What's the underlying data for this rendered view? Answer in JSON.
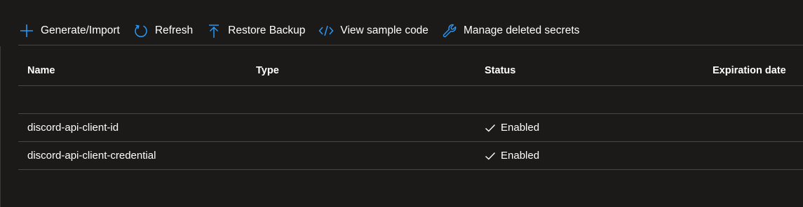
{
  "toolbar": {
    "generate": "Generate/Import",
    "refresh": "Refresh",
    "restore": "Restore Backup",
    "sample": "View sample code",
    "deleted": "Manage deleted secrets"
  },
  "icons": {
    "accent": "#2899f5"
  },
  "table": {
    "columns": [
      "Name",
      "Type",
      "Status",
      "Expiration date"
    ],
    "rows": [
      {
        "name": "discord-api-client-id",
        "type": "",
        "status": "Enabled",
        "expiration": ""
      },
      {
        "name": "discord-api-client-credential",
        "type": "",
        "status": "Enabled",
        "expiration": ""
      }
    ]
  }
}
